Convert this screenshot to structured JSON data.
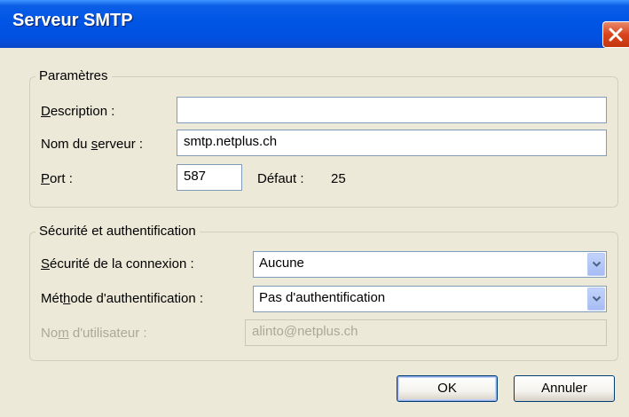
{
  "window": {
    "title": "Serveur SMTP",
    "close_icon": "close-icon"
  },
  "parametres": {
    "legend": "Paramètres",
    "description": {
      "label_before": "",
      "accel": "D",
      "label_after": "escription :",
      "value": ""
    },
    "server": {
      "label_before": "Nom du ",
      "accel": "s",
      "label_after": "erveur :",
      "value": "smtp.netplus.ch"
    },
    "port": {
      "label_before": "",
      "accel": "P",
      "label_after": "ort :",
      "value": "587"
    },
    "default": {
      "label": "Défaut :",
      "value": "25"
    }
  },
  "security": {
    "legend": "Sécurité et authentification",
    "connection": {
      "label_before": "",
      "accel": "S",
      "label_after": "écurité de la connexion :",
      "selected": "Aucune"
    },
    "auth_method": {
      "label_before": "Mét",
      "accel": "h",
      "label_after": "ode d'authentification :",
      "selected": "Pas d'authentification"
    },
    "username": {
      "label_before": "No",
      "accel": "m",
      "label_after": " d'utilisateur :",
      "value": "alinto@netplus.ch"
    }
  },
  "buttons": {
    "ok": "OK",
    "cancel": "Annuler"
  },
  "colors": {
    "titlebar": "#0055e5",
    "dialog_bg": "#ece9d8",
    "close": "#d9441c"
  }
}
